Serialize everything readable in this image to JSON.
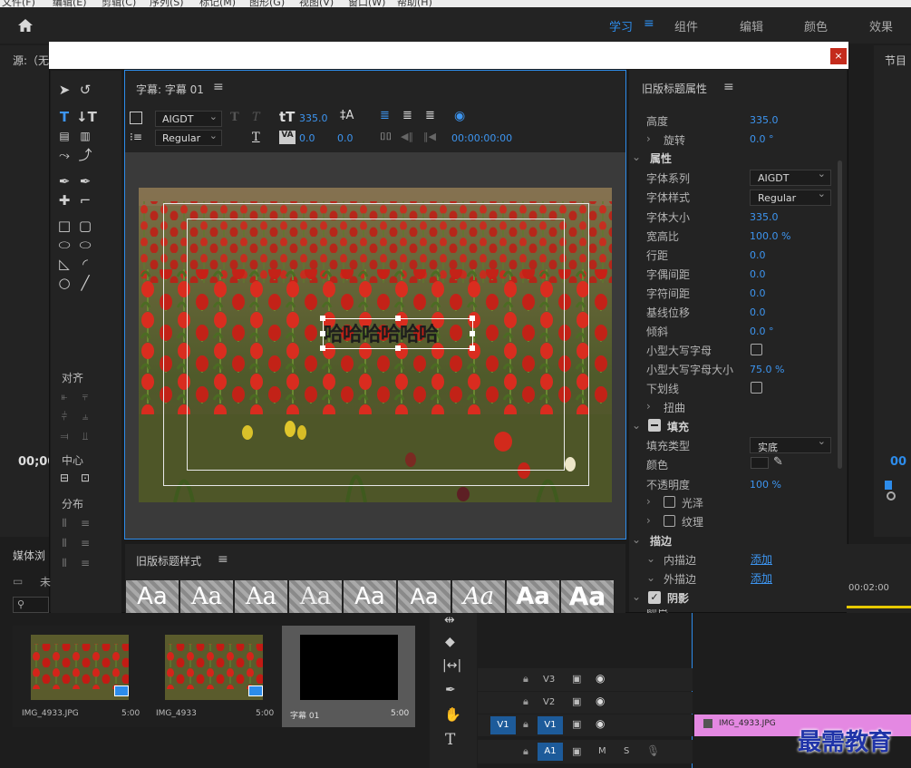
{
  "menubar": [
    "文件(F)",
    "编辑(E)",
    "剪辑(C)",
    "序列(S)",
    "标记(M)",
    "图形(G)",
    "视图(V)",
    "窗口(W)",
    "帮助(H)"
  ],
  "workspaces": [
    {
      "label": "学习",
      "active": true
    },
    {
      "label": "组件",
      "active": false
    },
    {
      "label": "编辑",
      "active": false
    },
    {
      "label": "颜色",
      "active": false
    },
    {
      "label": "效果",
      "active": false
    }
  ],
  "background": {
    "source_label": "源:（无",
    "program_label": "节目",
    "timecode_left": "00;00",
    "timecode_right": "00",
    "media_browser": "媒体浏",
    "folder_label": "未",
    "ruler_time": "00:02:00"
  },
  "dialog": {
    "close_label": "×",
    "main_title": "字幕: 字幕 01",
    "toolbar": {
      "font_family": "AIGDT",
      "font_style": "Regular",
      "font_size": "335.0",
      "kerning": "0.0",
      "leading": "0.0",
      "timecode": "00:00:00:00"
    },
    "tools": {
      "align_label": "对齐",
      "center_label": "中心",
      "distribute_label": "分布"
    },
    "canvas_text": "哈哈哈哈哈哈",
    "styles_title": "旧版标题样式",
    "style_samples": [
      "Aa",
      "Aa",
      "Aa",
      "Aa",
      "Aa",
      "Aa",
      "Aa",
      "Aa",
      "Aa"
    ]
  },
  "properties": {
    "title": "旧版标题属性",
    "rows": [
      {
        "label": "高度",
        "value": "335.0"
      },
      {
        "label": "旋转",
        "value": "0.0 °"
      }
    ],
    "section_properties": "属性",
    "font_family_label": "字体系列",
    "font_family_value": "AIGDT",
    "font_style_label": "字体样式",
    "font_style_value": "Regular",
    "attrs": [
      {
        "label": "字体大小",
        "value": "335.0"
      },
      {
        "label": "宽高比",
        "value": "100.0 %"
      },
      {
        "label": "行距",
        "value": "0.0"
      },
      {
        "label": "字偶间距",
        "value": "0.0"
      },
      {
        "label": "字符间距",
        "value": "0.0"
      },
      {
        "label": "基线位移",
        "value": "0.0"
      },
      {
        "label": "倾斜",
        "value": "0.0 °"
      }
    ],
    "small_caps_label": "小型大写字母",
    "small_caps_size_label": "小型大写字母大小",
    "small_caps_size_value": "75.0 %",
    "underline_label": "下划线",
    "distort_label": "扭曲",
    "section_fill": "填充",
    "fill_type_label": "填充类型",
    "fill_type_value": "实底",
    "color_label": "颜色",
    "opacity_label": "不透明度",
    "opacity_value": "100 %",
    "sheen_label": "光泽",
    "texture_label": "纹理",
    "section_stroke": "描边",
    "inner_stroke_label": "内描边",
    "outer_stroke_label": "外描边",
    "add_label": "添加",
    "section_shadow": "阴影",
    "shadow_color_label": "颜色"
  },
  "project": {
    "items": [
      {
        "name": "IMG_4933.JPG",
        "duration": "5:00"
      },
      {
        "name": "IMG_4933",
        "duration": "5:00"
      },
      {
        "name": "字幕 01",
        "duration": "5:00"
      }
    ]
  },
  "timeline": {
    "tracks": [
      "V3",
      "V2",
      "V1",
      "A1"
    ],
    "source_patch_v": "V1",
    "mute_label": "M",
    "solo_label": "S",
    "clip_name": "IMG_4933.JPG"
  },
  "watermark": "最需教育"
}
